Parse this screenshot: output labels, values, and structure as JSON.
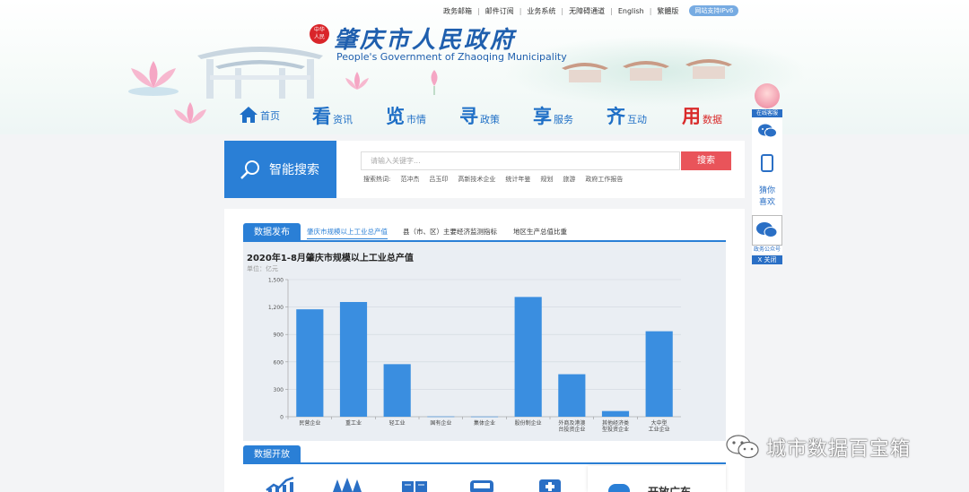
{
  "top_links": [
    "政务邮箱",
    "邮件订阅",
    "业务系统",
    "无障碍通道",
    "English",
    "繁體版"
  ],
  "ipv6_badge": "网站支持IPv6",
  "seal_text": "中华人民共和国",
  "site": {
    "title_cn": "肇庆市人民政府",
    "title_en": "People's Government of Zhaoqing Municipality"
  },
  "nav": [
    {
      "big": "",
      "small": "首页",
      "icon": "home-icon"
    },
    {
      "big": "看",
      "small": "资讯"
    },
    {
      "big": "览",
      "small": "市情"
    },
    {
      "big": "寻",
      "small": "政策"
    },
    {
      "big": "享",
      "small": "服务"
    },
    {
      "big": "齐",
      "small": "互动"
    },
    {
      "big": "用",
      "small": "数据"
    }
  ],
  "float": {
    "kefu": "在线客服",
    "guess": "猜你喜欢",
    "qr_label": "政务公众号",
    "close": "X 关闭"
  },
  "search": {
    "label": "智能搜索",
    "placeholder": "请输入关键字...",
    "button": "搜索",
    "hot_label": "搜索热词:",
    "hot_words": [
      "范冲杰",
      "吕玉印",
      "高新技术企业",
      "统计年鉴",
      "规划",
      "旅游",
      "政府工作报告"
    ]
  },
  "data_section": {
    "tab": "数据发布",
    "subtabs": [
      "肇庆市规模以上工业总产值",
      "县（市、区）主要经济监测指标",
      "地区生产总值比重"
    ],
    "active_subtab": 0
  },
  "open_section": {
    "tab": "数据开放",
    "card_text": "开放广东"
  },
  "chart_data": {
    "type": "bar",
    "title": "2020年1-8月肇庆市规模以上工业总产值",
    "unit": "单位：亿元",
    "categories": [
      "民营企业",
      "重工业",
      "轻工业",
      "国有企业",
      "集体企业",
      "股份制企业",
      "外商及港澳台投资企业",
      "其他经济类型投资企业",
      "大中型工业企业"
    ],
    "category_lines": [
      [
        "民营企业"
      ],
      [
        "重工业"
      ],
      [
        "轻工业"
      ],
      [
        "国有企业"
      ],
      [
        "集体企业"
      ],
      [
        "股份制企业"
      ],
      [
        "外商及港澳",
        "台投资企业"
      ],
      [
        "其他经济类",
        "型投资企业"
      ],
      [
        "大中型",
        "工业企业"
      ]
    ],
    "values": [
      1175,
      1255,
      575,
      3,
      2,
      1310,
      465,
      62,
      935
    ],
    "ylim": [
      0,
      1500
    ],
    "yticks": [
      "0",
      "300",
      "600",
      "900",
      "1,200",
      "1,500"
    ],
    "bar_color": "#3a8ee0"
  },
  "watermark": "城市数据百宝箱"
}
